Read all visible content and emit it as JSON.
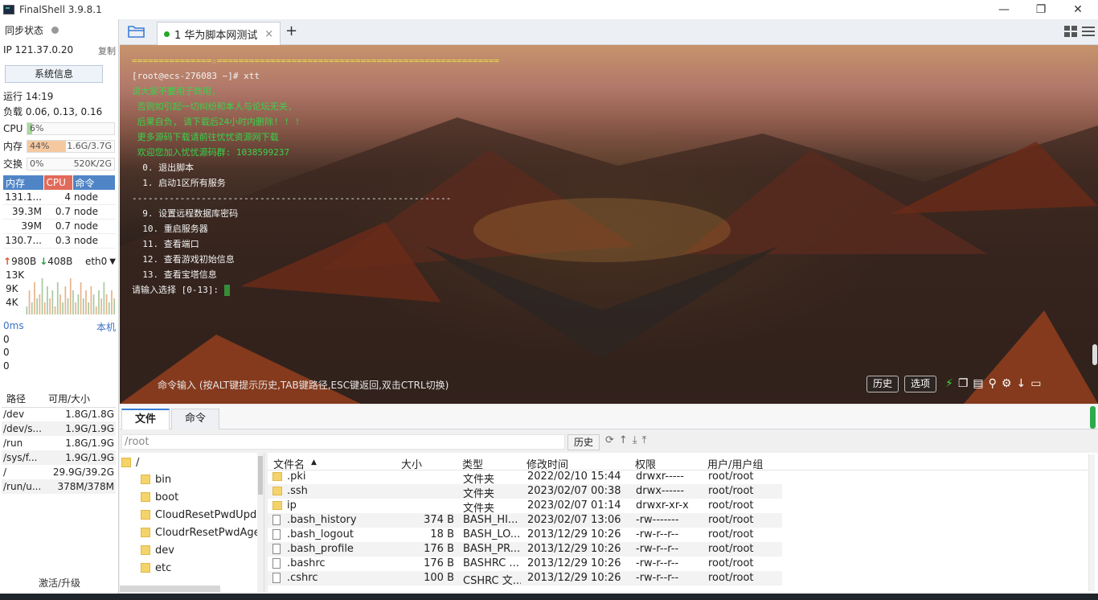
{
  "window": {
    "title": "FinalShell 3.9.8.1",
    "minimize": "—",
    "maximize": "❐",
    "close": "✕"
  },
  "sidebar": {
    "sync_label": "同步状态",
    "ip_label": "IP  121.37.0.20",
    "copy": "复制",
    "sysinfo_button": "系统信息",
    "uptime": "运行 14:19",
    "load": "负载 0.06, 0.13, 0.16",
    "cpu": {
      "label": "CPU",
      "pct": "6%",
      "value": 0.06,
      "color": "#a6d99b"
    },
    "mem": {
      "label": "内存",
      "pct": "44%",
      "detail": "1.6G/3.7G",
      "value": 0.44,
      "color": "#f5c9a0"
    },
    "swap": {
      "label": "交换",
      "pct": "0%",
      "detail": "520K/2G",
      "value": 0.0,
      "color": "#cfd8e3"
    },
    "proc_headers": [
      "内存",
      "CPU",
      "命令"
    ],
    "processes": [
      {
        "mem": "131.1...",
        "cpu": "4",
        "cmd": "node"
      },
      {
        "mem": "39.3M",
        "cpu": "0.7",
        "cmd": "node"
      },
      {
        "mem": "39M",
        "cpu": "0.7",
        "cmd": "node"
      },
      {
        "mem": "130.7...",
        "cpu": "0.3",
        "cmd": "node"
      }
    ],
    "net": {
      "up": "980B",
      "down": "408B",
      "iface": "eth0"
    },
    "net_ticks": [
      "13K",
      "9K",
      "4K"
    ],
    "net_bars": [
      0.2,
      0.6,
      0.3,
      0.8,
      0.4,
      0.5,
      0.9,
      0.3,
      0.7,
      0.4,
      0.6,
      0.2,
      0.8,
      0.5,
      0.3,
      0.7,
      0.4,
      0.9,
      0.6,
      0.3,
      0.5,
      0.8,
      0.4,
      0.6,
      0.3,
      0.7,
      0.5,
      0.2,
      0.6,
      0.4,
      0.8,
      0.5,
      0.3,
      0.6,
      0.4
    ],
    "latency": {
      "label": "0ms",
      "host": "本机",
      "values": [
        "0",
        "0",
        "0"
      ]
    },
    "disk_headers": [
      "路径",
      "可用/大小"
    ],
    "disks": [
      {
        "path": "/dev",
        "size": "1.8G/1.8G"
      },
      {
        "path": "/dev/s...",
        "size": "1.9G/1.9G"
      },
      {
        "path": "/run",
        "size": "1.8G/1.9G"
      },
      {
        "path": "/sys/f...",
        "size": "1.9G/1.9G"
      },
      {
        "path": "/",
        "size": "29.9G/39.2G"
      },
      {
        "path": "/run/u...",
        "size": "378M/378M"
      }
    ],
    "activate": "激活/升级"
  },
  "tabs": {
    "session_tab": "1  华为脚本网测试",
    "close": "×",
    "add": "+"
  },
  "terminal": {
    "lines": [
      {
        "text": "===============☆=====================================================",
        "color": "yel"
      },
      {
        "text": "[root@ecs-276083 ~]# xtt",
        "color": "wht"
      },
      {
        "text": "",
        "color": "wht"
      },
      {
        "text": "请大家不要用于商用,",
        "color": "grn"
      },
      {
        "text": " 否则如引起一切纠纷和本人与论坛无关,",
        "color": "grn"
      },
      {
        "text": " 后果自负, 请下载后24小时内删除! ! !",
        "color": "grn"
      },
      {
        "text": " 更多源码下载请前往忧忧资源网下载",
        "color": "grn"
      },
      {
        "text": " 欢迎您加入忧忧源码群: 1038599237",
        "color": "grn"
      },
      {
        "text": "",
        "color": "wht"
      },
      {
        "text": "  0. 退出脚本",
        "color": "wgrn"
      },
      {
        "text": "",
        "color": "wht"
      },
      {
        "text": "  1. 启动1区所有服务",
        "color": "wgrn"
      },
      {
        "text": "------------------------------------------------------------",
        "color": "wht"
      },
      {
        "text": "  9. 设置远程数据库密码",
        "color": "wgrn"
      },
      {
        "text": "  10. 重启服务器",
        "color": "wgrn"
      },
      {
        "text": "  11. 查看端口",
        "color": "wgrn"
      },
      {
        "text": "  12. 查看游戏初始信息",
        "color": "wgrn"
      },
      {
        "text": "  13. 查看宝塔信息",
        "color": "wgrn"
      },
      {
        "text": "",
        "color": "wht"
      },
      {
        "text": "请输入选择 [0-13]: ",
        "color": "wht"
      }
    ],
    "cmd_hint": "命令输入 (按ALT键提示历史,TAB键路径,ESC键返回,双击CTRL切换)",
    "history_btn": "历史",
    "options_btn": "选项"
  },
  "bottom": {
    "tab_files": "文件",
    "tab_commands": "命令",
    "path": "/root",
    "history_btn": "历史",
    "tree": [
      {
        "name": "/",
        "level": 0
      },
      {
        "name": "bin",
        "level": 1
      },
      {
        "name": "boot",
        "level": 1
      },
      {
        "name": "CloudResetPwdUpdateAgent",
        "level": 1
      },
      {
        "name": "CloudrResetPwdAgent",
        "level": 1
      },
      {
        "name": "dev",
        "level": 1
      },
      {
        "name": "etc",
        "level": 1
      }
    ],
    "file_headers": {
      "name": "文件名",
      "size": "大小",
      "type": "类型",
      "mtime": "修改时间",
      "perm": "权限",
      "owner": "用户/用户组"
    },
    "files": [
      {
        "name": ".pki",
        "size": "",
        "type": "文件夹",
        "mtime": "2022/02/10 15:44",
        "perm": "drwxr-----",
        "owner": "root/root",
        "dir": true
      },
      {
        "name": ".ssh",
        "size": "",
        "type": "文件夹",
        "mtime": "2023/02/07 00:38",
        "perm": "drwx------",
        "owner": "root/root",
        "dir": true
      },
      {
        "name": "ip",
        "size": "",
        "type": "文件夹",
        "mtime": "2023/02/07 01:14",
        "perm": "drwxr-xr-x",
        "owner": "root/root",
        "dir": true
      },
      {
        "name": ".bash_history",
        "size": "374 B",
        "type": "BASH_HI...",
        "mtime": "2023/02/07 13:06",
        "perm": "-rw-------",
        "owner": "root/root",
        "dir": false
      },
      {
        "name": ".bash_logout",
        "size": "18 B",
        "type": "BASH_LO...",
        "mtime": "2013/12/29 10:26",
        "perm": "-rw-r--r--",
        "owner": "root/root",
        "dir": false
      },
      {
        "name": ".bash_profile",
        "size": "176 B",
        "type": "BASH_PR...",
        "mtime": "2013/12/29 10:26",
        "perm": "-rw-r--r--",
        "owner": "root/root",
        "dir": false
      },
      {
        "name": ".bashrc",
        "size": "176 B",
        "type": "BASHRC ...",
        "mtime": "2013/12/29 10:26",
        "perm": "-rw-r--r--",
        "owner": "root/root",
        "dir": false
      },
      {
        "name": ".cshrc",
        "size": "100 B",
        "type": "CSHRC 文...",
        "mtime": "2013/12/29 10:26",
        "perm": "-rw-r--r--",
        "owner": "root/root",
        "dir": false
      }
    ]
  }
}
